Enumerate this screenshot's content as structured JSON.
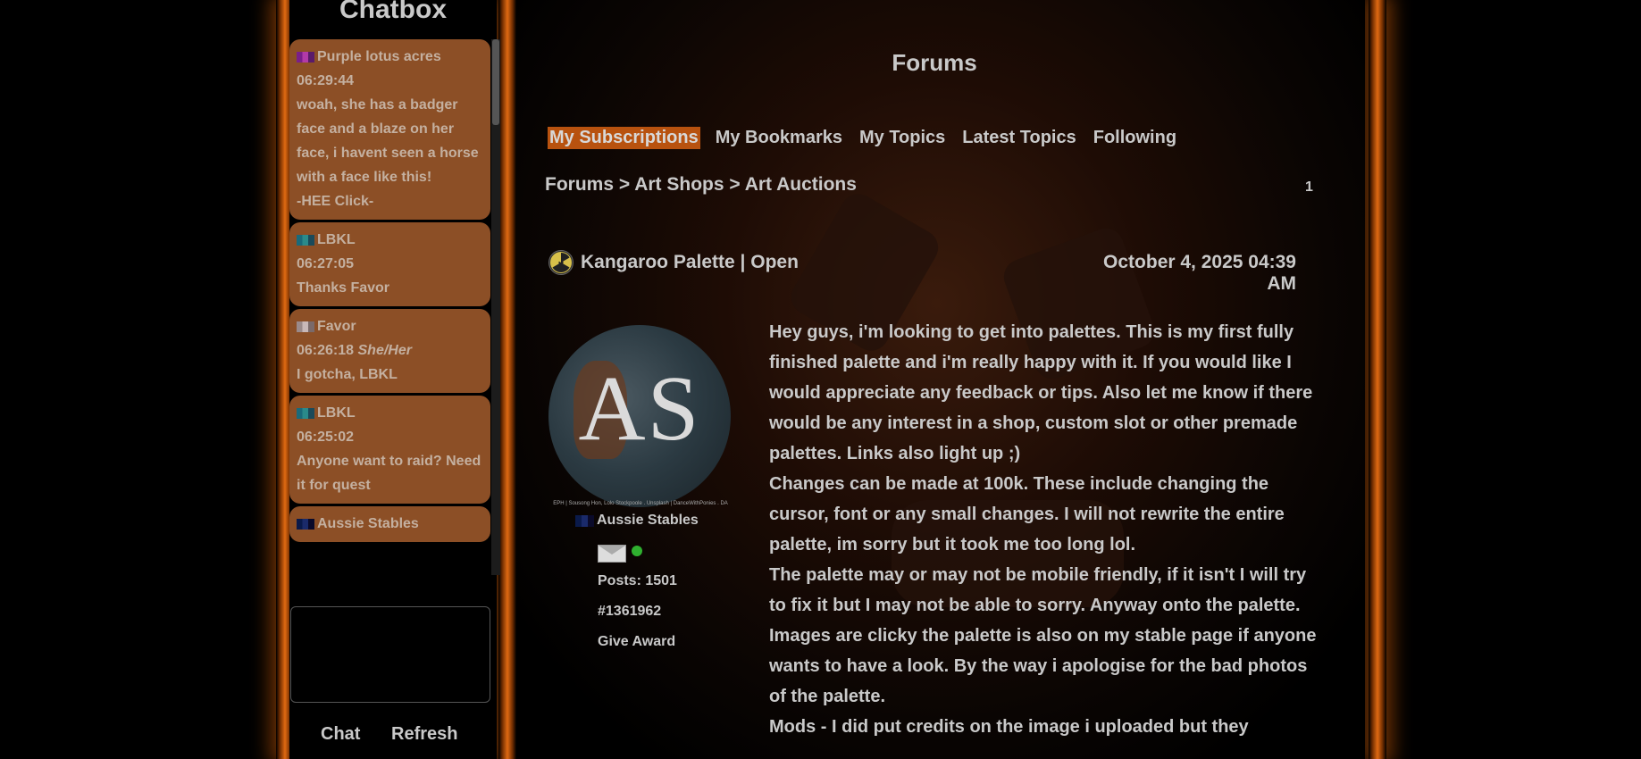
{
  "chatbox": {
    "title": "Chatbox",
    "messages": [
      {
        "user": "Purple lotus acres",
        "flag_colors": [
          "#7a1f8a",
          "#b23aa8",
          "#5a1a6a"
        ],
        "time": "06:29:44",
        "pronouns": "",
        "text": "woah, she has a badger face and a blaze on her face, i havent seen a horse with a face like this!\n-HEE Click-"
      },
      {
        "user": "LBKL",
        "flag_colors": [
          "#1a6a7a",
          "#2a8a8a",
          "#1a4a5a"
        ],
        "time": "06:27:05",
        "pronouns": "",
        "text": "Thanks Favor"
      },
      {
        "user": "Favor",
        "flag_colors": [
          "#9a8a8a",
          "#c8b8b8",
          "#7a6a6a"
        ],
        "time": "06:26:18",
        "pronouns": "She/Her",
        "text": "I gotcha, LBKL"
      },
      {
        "user": "LBKL",
        "flag_colors": [
          "#1a6a7a",
          "#2a8a8a",
          "#1a4a5a"
        ],
        "time": "06:25:02",
        "pronouns": "",
        "text": "Anyone want to raid? Need it for quest"
      },
      {
        "user": "Aussie Stables",
        "flag_colors": [
          "#0a1a4a",
          "#1a2a6a",
          "#0a0a2a"
        ],
        "time": "",
        "pronouns": "",
        "text": ""
      }
    ],
    "buttons": {
      "chat": "Chat",
      "refresh": "Refresh"
    }
  },
  "forums": {
    "title": "Forums",
    "tabs": [
      {
        "label": "My Subscriptions",
        "active": true
      },
      {
        "label": "My Bookmarks",
        "active": false
      },
      {
        "label": "My Topics",
        "active": false
      },
      {
        "label": "Latest Topics",
        "active": false
      },
      {
        "label": "Following",
        "active": false
      }
    ],
    "breadcrumb": {
      "forums": "Forums",
      "sep": ">",
      "shops": "Art Shops",
      "auctions": "Art Auctions"
    },
    "page_number": "1"
  },
  "topic": {
    "title": "Kangaroo Palette | Open",
    "date": "October 4, 2025 04:39 AM",
    "icon": "radiation-icon"
  },
  "author": {
    "avatar_letters": "AS",
    "avatar_caption": "EPH | Sousong Hon, Lolo Stockpoole . Unsplash | DanceWithPonies . DA",
    "name": "Aussie Stables",
    "posts": "Posts: 1501",
    "post_id": "#1361962",
    "give_award": "Give Award",
    "online_color": "#2fb02f"
  },
  "post": {
    "paragraphs": [
      "Hey guys, i'm looking to get into palettes. This is my first fully finished palette and i'm really happy with it. If you would like I would appreciate any feedback or tips. Also let me know if there would be any interest in a shop, custom slot or other premade palettes. Links also light up ;)",
      "Changes can be made at 100k. These include changing the cursor, font or any small changes. I will not rewrite the entire palette, im sorry but it took me too long lol.",
      "The palette may or may not be mobile friendly, if it isn't I will try to fix it but I may not be able to sorry. Anyway onto the palette.",
      "Images are clicky the palette is also on my stable page if anyone wants to have a look. By the way i apologise for the bad photos of the palette.",
      "Mods - I did put credits on the image i uploaded but they"
    ]
  },
  "colors": {
    "accent": "#b8520f",
    "chat_bubble": "#8c4f26",
    "glow": "#e06a12"
  }
}
